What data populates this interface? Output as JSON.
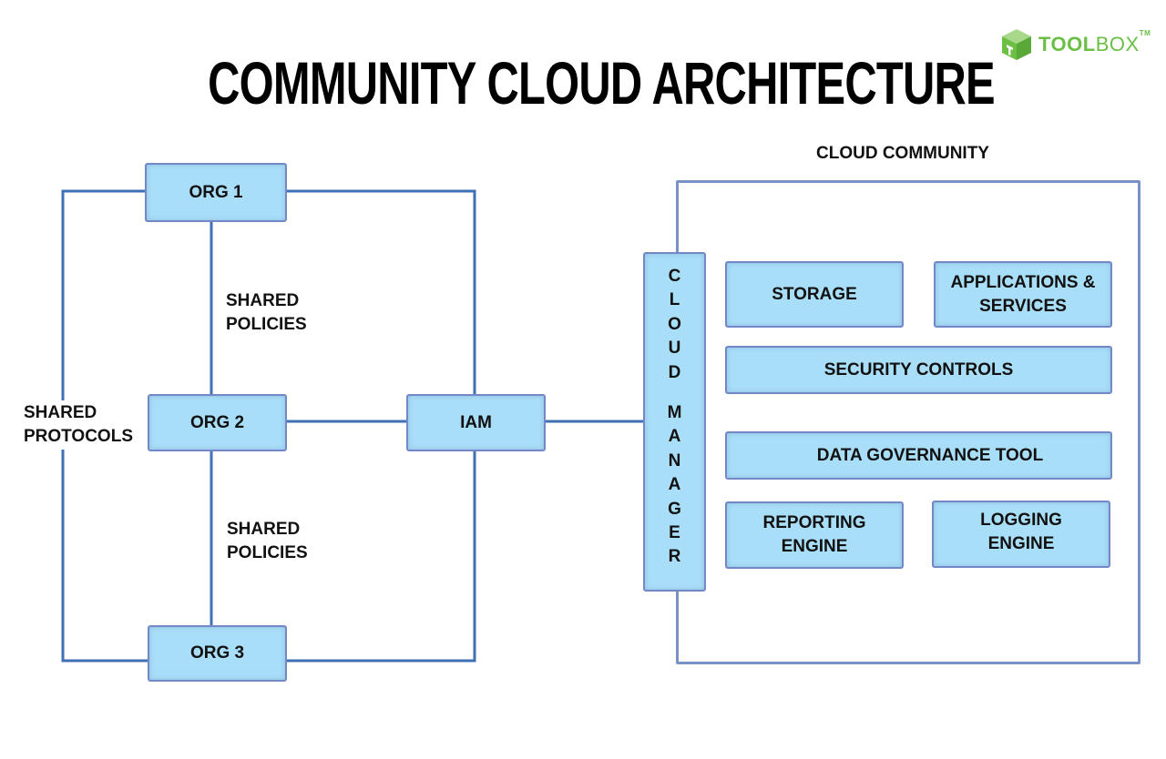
{
  "title": "COMMUNITY CLOUD ARCHITECTURE",
  "logo": {
    "bold": "TOOL",
    "light": "BOX",
    "tm": "TM",
    "color": "#6bbf45"
  },
  "colors": {
    "box_fill": "#a9def8",
    "box_border": "#7487c6",
    "connector": "#3f6fb5"
  },
  "left": {
    "orgs": [
      "ORG 1",
      "ORG 2",
      "ORG 3"
    ],
    "iam": "IAM",
    "shared_policies_top": [
      "SHARED",
      "POLICIES"
    ],
    "shared_policies_bottom": [
      "SHARED",
      "POLICIES"
    ],
    "shared_protocols": [
      "SHARED",
      "PROTOCOLS"
    ]
  },
  "community": {
    "heading": "CLOUD COMMUNITY",
    "manager_word1": [
      "C",
      "L",
      "O",
      "U",
      "D"
    ],
    "manager_word2": [
      "M",
      "A",
      "N",
      "A",
      "G",
      "E",
      "R"
    ],
    "components": {
      "storage": "STORAGE",
      "apps": [
        "APPLICATIONS &",
        "SERVICES"
      ],
      "security": "SECURITY CONTROLS",
      "governance": "DATA GOVERNANCE TOOL",
      "reporting": [
        "REPORTING",
        "ENGINE"
      ],
      "logging": [
        "LOGGING",
        "ENGINE"
      ]
    }
  }
}
